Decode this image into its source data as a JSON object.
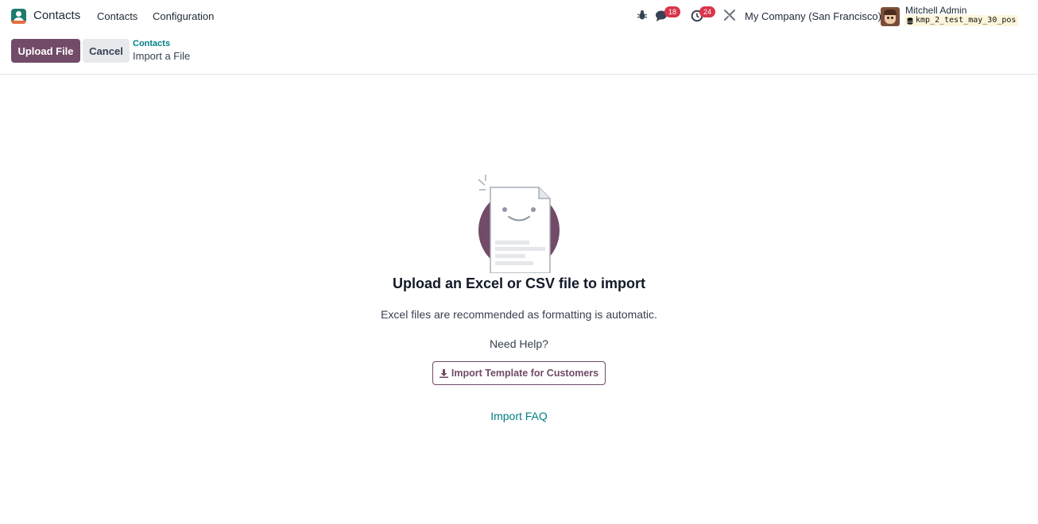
{
  "navbar": {
    "app_name": "Contacts",
    "menus": [
      "Contacts",
      "Configuration"
    ],
    "chat_badge": "18",
    "activity_badge": "24",
    "company": "My Company (San Francisco)",
    "user_name": "Mitchell Admin",
    "database": "kmp_2_test_may_30_pos",
    "icons": [
      "bug-icon",
      "chat-icon",
      "clock-icon",
      "tools-icon",
      "database-icon"
    ]
  },
  "control_panel": {
    "upload_label": "Upload File",
    "cancel_label": "Cancel",
    "breadcrumb_parent": "Contacts",
    "breadcrumb_current": "Import a File"
  },
  "main": {
    "title": "Upload an Excel or CSV file to import",
    "hint": "Excel files are recommended as formatting is automatic.",
    "need_help": "Need Help?",
    "template_button": "Import Template for Customers",
    "faq_link": "Import FAQ"
  },
  "colors": {
    "primary": "#714b67",
    "link": "#017e84",
    "badge": "#d9344b",
    "app_icon": "#1d7b6c"
  }
}
